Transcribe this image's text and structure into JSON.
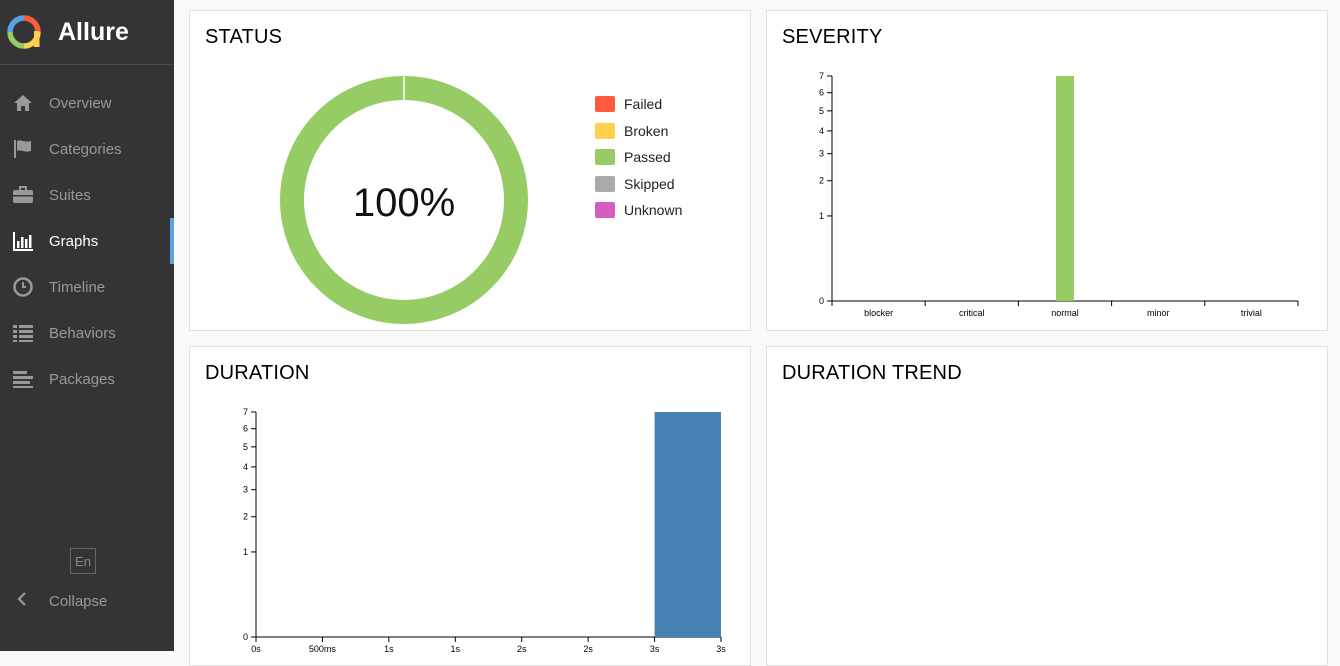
{
  "app": {
    "name": "Allure"
  },
  "sidebar": {
    "items": [
      {
        "label": "Overview",
        "icon": "home-icon"
      },
      {
        "label": "Categories",
        "icon": "flag-icon"
      },
      {
        "label": "Suites",
        "icon": "briefcase-icon"
      },
      {
        "label": "Graphs",
        "icon": "bar-chart-icon",
        "active": true
      },
      {
        "label": "Timeline",
        "icon": "clock-icon"
      },
      {
        "label": "Behaviors",
        "icon": "list-icon"
      },
      {
        "label": "Packages",
        "icon": "align-left-icon"
      }
    ],
    "language": "En",
    "collapse_label": "Collapse"
  },
  "colors": {
    "failed": "#fd5a3e",
    "broken": "#ffd050",
    "passed": "#97cc64",
    "skipped": "#aaaaaa",
    "unknown": "#d35ebe",
    "duration_bar": "#4682b4",
    "accent": "#5aa2e6"
  },
  "widgets": {
    "status": {
      "title": "STATUS",
      "center_label": "100%"
    },
    "severity": {
      "title": "SEVERITY"
    },
    "duration": {
      "title": "DURATION"
    },
    "trend": {
      "title": "DURATION TREND"
    }
  },
  "chart_data": [
    {
      "type": "pie",
      "title": "STATUS",
      "categories": [
        "Failed",
        "Broken",
        "Passed",
        "Skipped",
        "Unknown"
      ],
      "values": [
        0,
        0,
        7,
        0,
        0
      ],
      "center_label": "100%"
    },
    {
      "type": "bar",
      "title": "SEVERITY",
      "categories": [
        "blocker",
        "critical",
        "normal",
        "minor",
        "trivial"
      ],
      "values": [
        0,
        0,
        7,
        0,
        0
      ],
      "yticks": [
        0,
        1,
        2,
        3,
        4,
        5,
        6,
        7
      ],
      "ylim": [
        0,
        7
      ],
      "yscale": "sqrt",
      "grid": false
    },
    {
      "type": "bar",
      "title": "DURATION",
      "xtick_labels": [
        "0s",
        "500ms",
        "1s",
        "1s",
        "2s",
        "2s",
        "3s",
        "3s"
      ],
      "bins": [
        {
          "label": "0s–500ms",
          "value": 0
        },
        {
          "label": "500ms–1s",
          "value": 0
        },
        {
          "label": "1s–1s",
          "value": 0
        },
        {
          "label": "1s–2s",
          "value": 0
        },
        {
          "label": "2s–2s",
          "value": 0
        },
        {
          "label": "2s–3s",
          "value": 0
        },
        {
          "label": "3s–3s",
          "value": 7
        }
      ],
      "yticks": [
        0,
        1,
        2,
        3,
        4,
        5,
        6,
        7
      ],
      "ylim": [
        0,
        7
      ],
      "yscale": "sqrt",
      "grid": false
    }
  ]
}
